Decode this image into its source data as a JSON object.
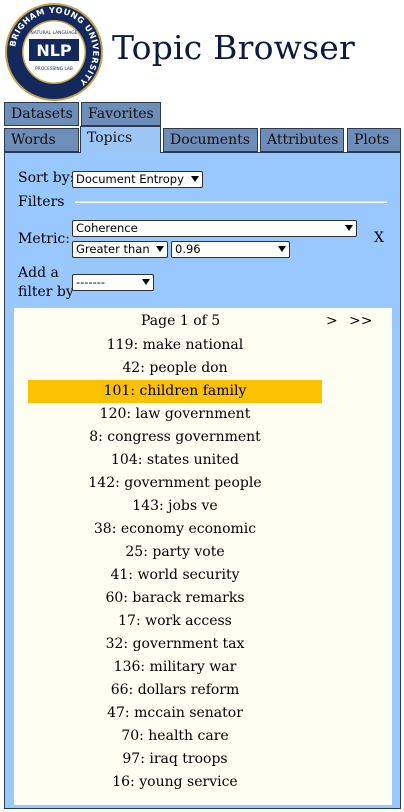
{
  "header": {
    "title": "Topic Browser",
    "logo": {
      "ring_text": "BRIGHAM YOUNG UNIVERSITY",
      "inner_top": "NATURAL LANGUAGE",
      "center": "NLP",
      "inner_bottom": "PROCESSING LAB"
    }
  },
  "tabs_row1": [
    {
      "label": "Datasets"
    },
    {
      "label": "Favorites"
    }
  ],
  "tabs_row2": [
    {
      "label": "Words"
    },
    {
      "label": "Topics"
    },
    {
      "label": "Documents"
    },
    {
      "label": "Attributes"
    },
    {
      "label": "Plots"
    }
  ],
  "active_tab": "Topics",
  "controls": {
    "sort_label": "Sort by:",
    "sort_value": "Document Entropy",
    "filters_label": "Filters",
    "metric_label": "Metric:",
    "metric_value": "Coherence",
    "comparison_value": "Greater than",
    "threshold_value": "0.96",
    "remove_label": "X",
    "add_filter_label_1": "Add a",
    "add_filter_label_2": "filter by",
    "add_filter_value": "-------"
  },
  "pagination": {
    "text": "Page 1 of 5",
    "next": ">",
    "last": ">>"
  },
  "topics": [
    "119: make national",
    "42: people don",
    "101: children family",
    "120: law government",
    "8: congress government",
    "104: states united",
    "142: government people",
    "143: jobs ve",
    "38: economy economic",
    "25: party vote",
    "41: world security",
    "60: barack remarks",
    "17: work access",
    "32: government tax",
    "136: military war",
    "66: dollars reform",
    "47: mccain senator",
    "70: health care",
    "97: iraq troops",
    "16: young service"
  ],
  "highlighted_topic": "101: children family",
  "colors": {
    "panel": "#99c8ff",
    "tab": "#6f8db9",
    "list_bg": "#fefef3",
    "highlight": "#fbc102",
    "title": "#0c1a3f"
  }
}
